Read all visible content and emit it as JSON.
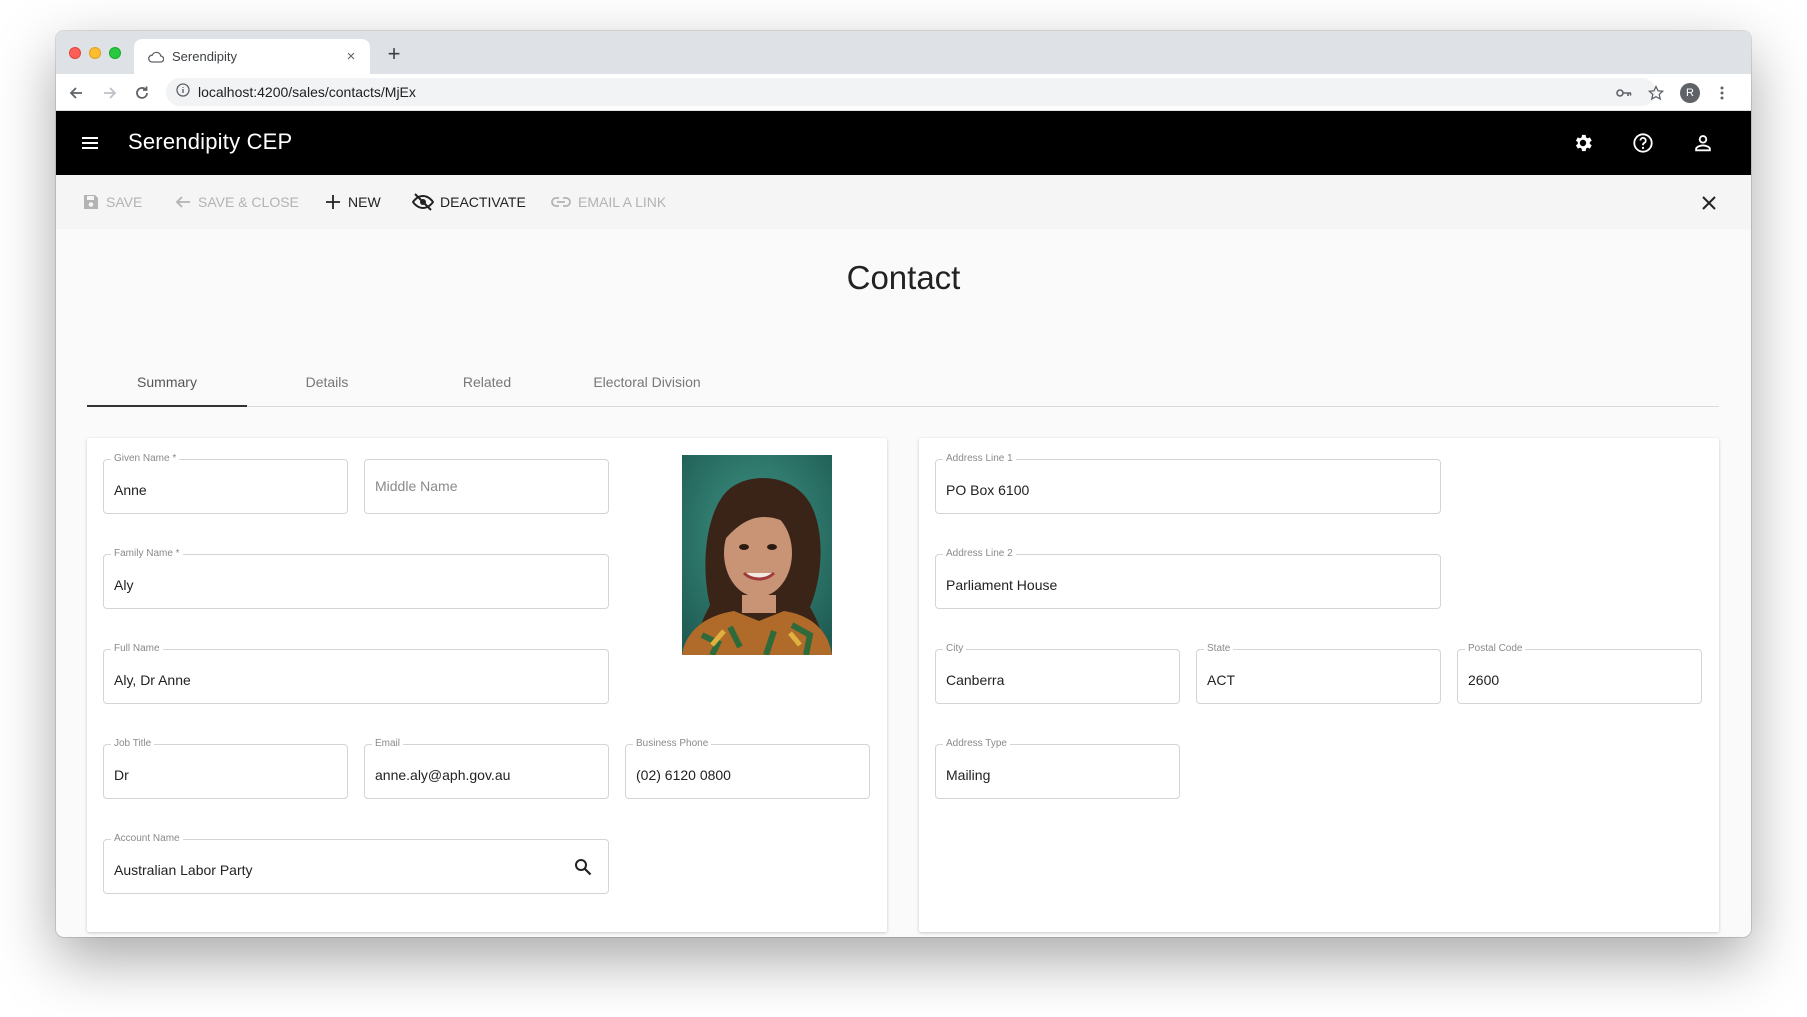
{
  "browser": {
    "tab_title": "Serendipity",
    "tab_close": "×",
    "new_tab": "+",
    "url": "localhost:4200/sales/contacts/MjEx",
    "profile_initial": "R"
  },
  "appbar": {
    "brand": "Serendipity CEP"
  },
  "toolbar": {
    "save": "Save",
    "save_close": "Save & Close",
    "new": "New",
    "deactivate": "Deactivate",
    "email_link": "Email a Link"
  },
  "page": {
    "title": "Contact"
  },
  "tabs": [
    "Summary",
    "Details",
    "Related",
    "Electoral Division"
  ],
  "active_tab": "Summary",
  "contact": {
    "given_name": {
      "label": "Given Name *",
      "value": "Anne"
    },
    "middle_name": {
      "placeholder": "Middle Name",
      "value": ""
    },
    "family_name": {
      "label": "Family Name *",
      "value": "Aly"
    },
    "full_name": {
      "label": "Full Name",
      "value": "Aly, Dr Anne"
    },
    "job_title": {
      "label": "Job Title",
      "value": "Dr"
    },
    "email": {
      "label": "Email",
      "value": "anne.aly@aph.gov.au"
    },
    "business_phone": {
      "label": "Business Phone",
      "value": "(02) 6120 0800"
    },
    "account_name": {
      "label": "Account Name",
      "value": "Australian Labor Party"
    }
  },
  "address": {
    "line1": {
      "label": "Address Line 1",
      "value": "PO Box 6100"
    },
    "line2": {
      "label": "Address Line 2",
      "value": "Parliament House"
    },
    "city": {
      "label": "City",
      "value": "Canberra"
    },
    "state": {
      "label": "State",
      "value": "ACT"
    },
    "postal_code": {
      "label": "Postal Code",
      "value": "2600"
    },
    "address_type": {
      "label": "Address Type",
      "value": "Mailing"
    }
  },
  "colors": {
    "appbar_bg": "#000000",
    "photo_bg": "#2e7a6e"
  },
  "icons": {
    "favicon": "cloud-icon",
    "save": "save-icon",
    "save_close": "arrow-back-icon",
    "new": "plus-icon",
    "deactivate": "eye-off-icon",
    "email_link": "link-icon",
    "settings": "gear-icon",
    "help": "help-icon",
    "account": "person-icon",
    "close": "close-icon",
    "lookup": "search-icon"
  }
}
